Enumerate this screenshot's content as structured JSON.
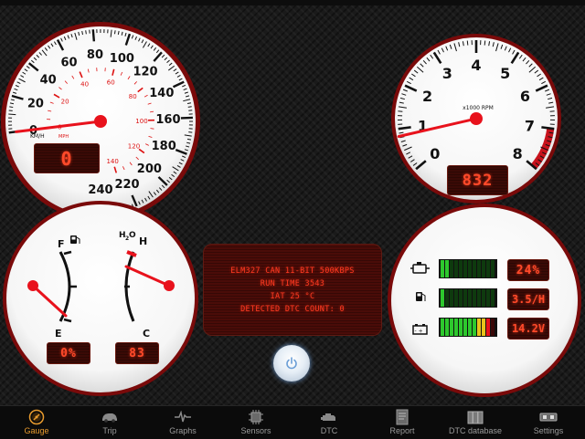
{
  "speedometer": {
    "kmh_ticks": [
      "0",
      "20",
      "40",
      "60",
      "80",
      "100",
      "120",
      "140",
      "160",
      "180",
      "200",
      "220",
      "240"
    ],
    "mph_ticks": [
      "0",
      "20",
      "40",
      "60",
      "80",
      "100",
      "120",
      "140"
    ],
    "unit_kmh": "KM/H",
    "unit_mph": "MPH",
    "speed_value": 0,
    "display": "0"
  },
  "tachometer": {
    "ticks": [
      "0",
      "1",
      "2",
      "3",
      "4",
      "5",
      "6",
      "7",
      "8"
    ],
    "unit_label": "x1000 RPM",
    "rpm_value": 0.832,
    "display": "832"
  },
  "fuel_temp": {
    "fuel_full": "F",
    "fuel_empty": "E",
    "temp_hot": "H",
    "temp_cold": "C",
    "fuel_display": "0%",
    "temp_display": "83"
  },
  "status": {
    "line1": "ELM327 CAN 11-BIT 500KBPS",
    "line2": "RUN TIME 3543",
    "line3": "IAT 25 °C",
    "line4": "DETECTED DTC COUNT: 0"
  },
  "meters": {
    "load_display": "24%",
    "fuel_rate_display": "3.5/H",
    "voltage_display": "14.2V",
    "load_lit_segments": 2,
    "fuel_lit_segments": 1,
    "voltage_lit_segments": 8
  },
  "tabs": [
    {
      "label": "Gauge",
      "icon": "gauge-icon",
      "active": true
    },
    {
      "label": "Trip",
      "icon": "car-icon",
      "active": false
    },
    {
      "label": "Graphs",
      "icon": "graph-icon",
      "active": false
    },
    {
      "label": "Sensors",
      "icon": "chip-icon",
      "active": false
    },
    {
      "label": "DTC",
      "icon": "engine-icon",
      "active": false
    },
    {
      "label": "Report",
      "icon": "report-icon",
      "active": false
    },
    {
      "label": "DTC database",
      "icon": "database-icon",
      "active": false
    },
    {
      "label": "Settings",
      "icon": "settings-icon",
      "active": false
    }
  ],
  "colors": {
    "accent_red": "#e8121c",
    "lcd_text": "#ff4a2a",
    "active_tab": "#e89b2e"
  }
}
